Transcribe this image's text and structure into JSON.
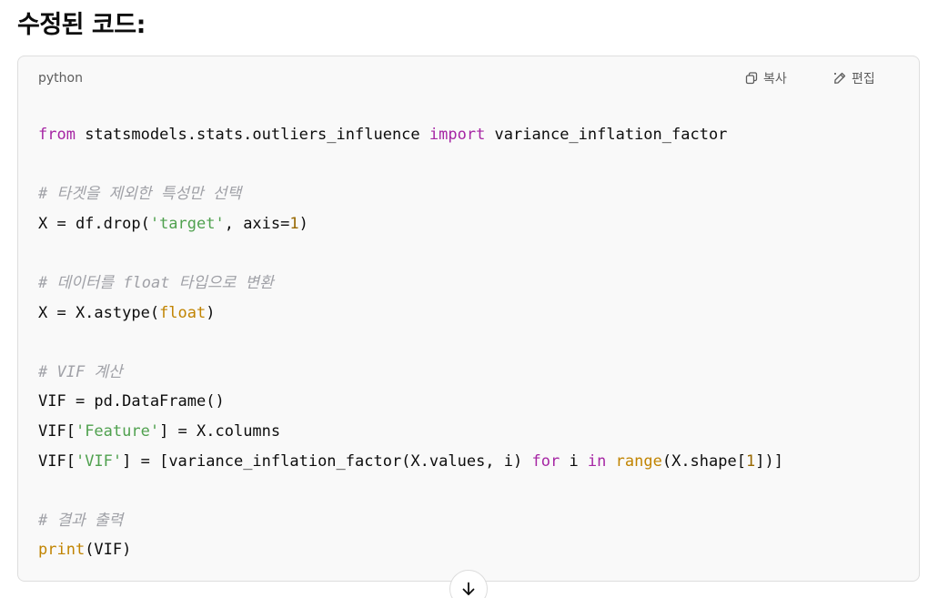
{
  "heading": "수정된 코드:",
  "code_block": {
    "language": "python",
    "copy_label": "복사",
    "edit_label": "편집",
    "copy_icon": "copy-icon",
    "edit_icon": "pencil-icon",
    "lines": [
      [
        {
          "t": "from",
          "c": "kw"
        },
        {
          "t": " statsmodels.stats.outliers_influence ",
          "c": ""
        },
        {
          "t": "import",
          "c": "kw"
        },
        {
          "t": " variance_inflation_factor",
          "c": ""
        }
      ],
      [],
      [
        {
          "t": "# 타겟을 제외한 특성만 선택",
          "c": "cm"
        }
      ],
      [
        {
          "t": "X = df.drop(",
          "c": ""
        },
        {
          "t": "'target'",
          "c": "str"
        },
        {
          "t": ", axis=",
          "c": ""
        },
        {
          "t": "1",
          "c": "num"
        },
        {
          "t": ")",
          "c": ""
        }
      ],
      [],
      [
        {
          "t": "# 데이터를 float 타입으로 변환",
          "c": "cm"
        }
      ],
      [
        {
          "t": "X = X.astype(",
          "c": ""
        },
        {
          "t": "float",
          "c": "bi"
        },
        {
          "t": ")",
          "c": ""
        }
      ],
      [],
      [
        {
          "t": "# VIF 계산",
          "c": "cm"
        }
      ],
      [
        {
          "t": "VIF = pd.DataFrame()",
          "c": ""
        }
      ],
      [
        {
          "t": "VIF[",
          "c": ""
        },
        {
          "t": "'Feature'",
          "c": "str"
        },
        {
          "t": "] = X.columns",
          "c": ""
        }
      ],
      [
        {
          "t": "VIF[",
          "c": ""
        },
        {
          "t": "'VIF'",
          "c": "str"
        },
        {
          "t": "] = [variance_inflation_factor(X.values, i) ",
          "c": ""
        },
        {
          "t": "for",
          "c": "kw"
        },
        {
          "t": " i ",
          "c": ""
        },
        {
          "t": "in",
          "c": "kw"
        },
        {
          "t": " ",
          "c": ""
        },
        {
          "t": "range",
          "c": "bi"
        },
        {
          "t": "(X.shape[",
          "c": ""
        },
        {
          "t": "1",
          "c": "num"
        },
        {
          "t": "])]",
          "c": ""
        }
      ],
      [],
      [
        {
          "t": "# 결과 출력",
          "c": "cm"
        }
      ],
      [
        {
          "t": "print",
          "c": "bi"
        },
        {
          "t": "(VIF)",
          "c": ""
        }
      ]
    ]
  },
  "scroll_button": {
    "icon": "arrow-down-icon"
  },
  "colors": {
    "keyword": "#a626a4",
    "string": "#50a14f",
    "number": "#986801",
    "builtin": "#c18401",
    "comment": "#a0a1a7",
    "code_bg": "#f9f9f9"
  }
}
